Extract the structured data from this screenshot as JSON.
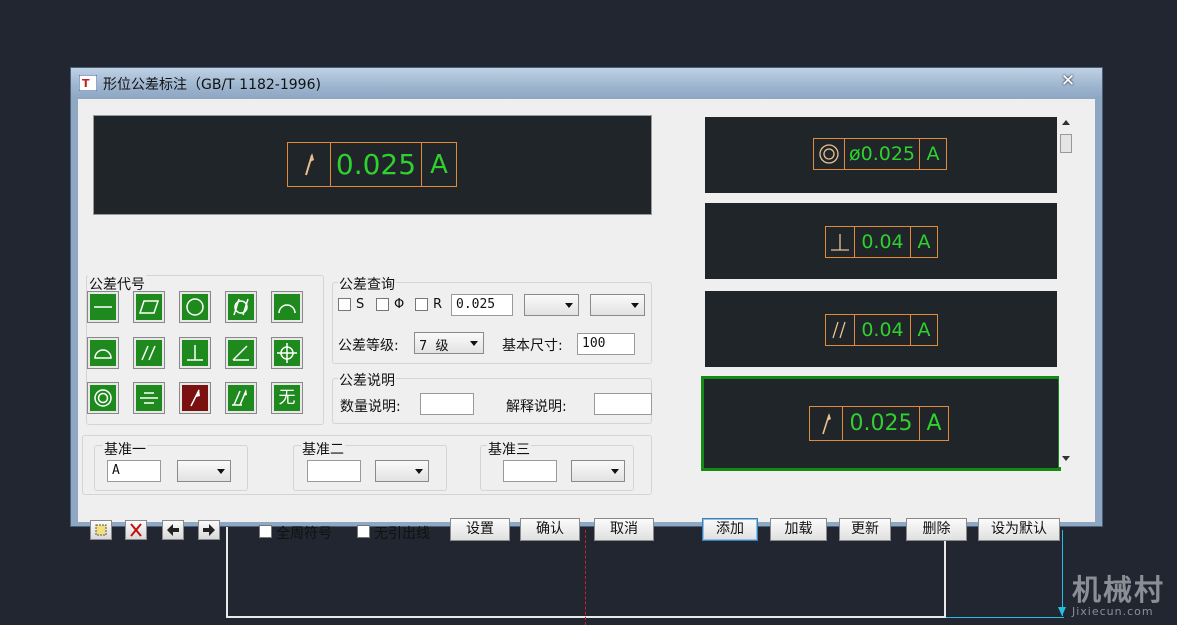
{
  "window": {
    "title": "形位公差标注（GB/T 1182-1996)",
    "close_label": "✕"
  },
  "preview": {
    "symbol": "circular-runout",
    "value": "0.025",
    "datum": "A"
  },
  "tol_code": {
    "title": "公差代号",
    "symbols": [
      "straightness",
      "flatness",
      "circularity",
      "cylindricity",
      "line-profile",
      "surface-profile",
      "parallelism",
      "perpendicularity",
      "angularity",
      "position",
      "concentricity",
      "symmetry",
      "circular-runout",
      "total-runout",
      "none"
    ],
    "none_label": "无",
    "active": "circular-runout"
  },
  "tol_query": {
    "title": "公差查询",
    "s_label": "S",
    "phi_label": "Φ",
    "r_label": "R",
    "value": "0.025",
    "grade_label": "公差等级:",
    "grade_value": "7  级",
    "base_size_label": "基本尺寸:",
    "base_size_value": "100"
  },
  "tol_desc": {
    "title": "公差说明",
    "qty_label": "数量说明:",
    "explain_label": "解释说明:"
  },
  "datums": {
    "d1_title": "基准一",
    "d1_value": "A",
    "d2_title": "基准二",
    "d2_value": "",
    "d3_title": "基准三",
    "d3_value": ""
  },
  "bottom": {
    "all_around_label": "全周符号",
    "no_leader_label": "无引出线",
    "settings_btn": "设置",
    "ok_btn": "确认",
    "cancel_btn": "取消"
  },
  "history": {
    "items": [
      {
        "symbol": "concentricity",
        "value": "ø0.025",
        "datum": "A"
      },
      {
        "symbol": "perpendicularity",
        "value": "0.04",
        "datum": "A"
      },
      {
        "symbol": "parallelism",
        "value": "0.04",
        "datum": "A"
      },
      {
        "symbol": "circular-runout",
        "value": "0.025",
        "datum": "A"
      }
    ],
    "selected_index": 3,
    "add_btn": "添加",
    "load_btn": "加载",
    "update_btn": "更新",
    "delete_btn": "删除",
    "default_btn": "设为默认"
  },
  "watermark": {
    "cn": "机械村",
    "en": "Jixiecun.com"
  },
  "colors": {
    "frame": "#e08a3a",
    "text": "#2fd02f",
    "button_green": "#1e8a1e",
    "button_active": "#7a1010"
  }
}
